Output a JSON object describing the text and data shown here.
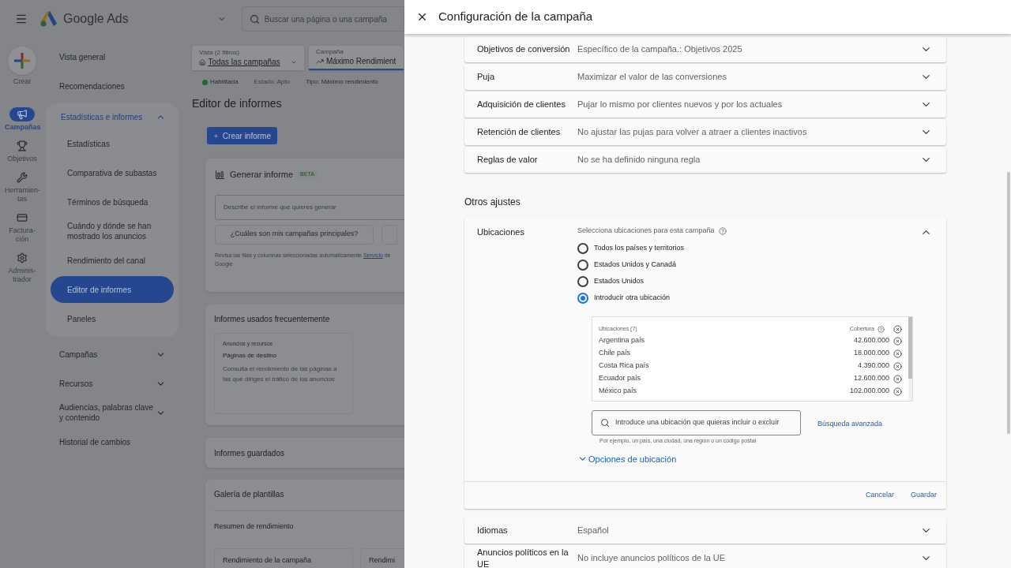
{
  "app": {
    "logo_text": "Google Ads",
    "search": {
      "placeholder": "Buscar una página o una campaña"
    }
  },
  "rail": [
    {
      "label": "Crear",
      "kind": "create",
      "selected": false
    },
    {
      "label": "Campañas",
      "kind": "campaigns",
      "selected": true
    },
    {
      "label": "Objetivos",
      "kind": "goals",
      "selected": false
    },
    {
      "label": "Herramien-tas",
      "kind": "tools",
      "selected": false
    },
    {
      "label": "Factura-ción",
      "kind": "billing",
      "selected": false
    },
    {
      "label": "Adminis-trador",
      "kind": "admin",
      "selected": false
    }
  ],
  "nav": [
    {
      "label": "Vista general",
      "selected": false
    },
    {
      "label": "Recomendaciones",
      "selected": false
    },
    {
      "label": "Estadísticas e informes",
      "selected": false,
      "expanded": true,
      "children": [
        {
          "label": "Estadísticas",
          "selected": false
        },
        {
          "label": "Comparativa de subastas",
          "selected": false
        },
        {
          "label": "Términos de búsqueda",
          "selected": false
        },
        {
          "label": "Cuándo y dónde se han mostrado los anuncios",
          "selected": false
        },
        {
          "label": "Rendimiento del canal",
          "selected": false
        },
        {
          "label": "Editor de informes",
          "selected": true
        },
        {
          "label": "Paneles",
          "selected": false
        }
      ]
    },
    {
      "label": "Campañas",
      "selected": false,
      "expanded": false
    },
    {
      "label": "Recursos",
      "selected": false,
      "expanded": false
    },
    {
      "label": "Audiencias, palabras clave y contenido",
      "selected": false,
      "expanded": false
    },
    {
      "label": "Historial de cambios",
      "selected": false
    }
  ],
  "main": {
    "filters": [
      {
        "label": "Vista (2 filtros)",
        "value": "Todas las campañas",
        "kind": "view"
      },
      {
        "label": "Campaña",
        "value": "Máximo Rendimient",
        "kind": "campaign"
      }
    ],
    "status": {
      "state": "Habilitada",
      "eligibility_label": "Estado:",
      "eligibility": "Apto",
      "type_label": "Tipo:",
      "type": "Máximo rendimiento"
    },
    "title": "Editor de informes",
    "create_button": "Crear informe",
    "generate": {
      "title": "Generar informe",
      "badge": "BETA",
      "placeholder": "Describe el informe que quieres generar",
      "suggestion": "¿Cuáles son mis campañas principales?",
      "note": "Revisa las filas y columnas seleccionadas automáticamente",
      "link": "Servicio",
      "note_end": "de Google"
    },
    "frequent": {
      "title": "Informes usados frecuentemente",
      "card": {
        "category": "Anuncios y recursos",
        "title": "Páginas de destino",
        "description": "Consulta el rendimiento de las páginas a las que diriges el tráfico de los anuncios"
      }
    },
    "saved": {
      "title": "Informes guardados"
    },
    "gallery": {
      "title": "Galería de plantillas",
      "section": "Resumen de rendimiento",
      "cards": [
        "Rendimiento de la campaña",
        "Rendimi"
      ]
    }
  },
  "panel": {
    "title": "Configuración de la campaña",
    "settings": [
      {
        "label": "Objetivos de conversión",
        "value": "Específico de la campaña.: Objetivos 2025",
        "expanded": false
      },
      {
        "label": "Puja",
        "value": "Maximizar el valor de las conversiones",
        "expanded": false
      },
      {
        "label": "Adquisición de clientes",
        "value": "Pujar lo mismo por clientes nuevos y por los actuales",
        "expanded": false
      },
      {
        "label": "Retención de clientes",
        "value": "No ajustar las pujas para volver a atraer a clientes inactivos",
        "expanded": false
      },
      {
        "label": "Reglas de valor",
        "value": "No se ha definido ninguna regla",
        "expanded": false
      }
    ],
    "section_title": "Otros ajustes",
    "locations": {
      "label": "Ubicaciones",
      "expanded": true,
      "prompt": "Selecciona ubicaciones para esta campaña",
      "options": [
        {
          "label": "Todos los países y territorios",
          "selected": false
        },
        {
          "label": "Estados Unidos y Canadá",
          "selected": false
        },
        {
          "label": "Estados Unidos",
          "selected": false
        },
        {
          "label": "Introducir otra ubicación",
          "selected": true
        }
      ],
      "table": {
        "header": "Ubicaciones (7)",
        "coverage_header": "Cobertura",
        "rows": [
          {
            "name": "Argentina país",
            "coverage": "42.600.000"
          },
          {
            "name": "Chile país",
            "coverage": "18.000.000"
          },
          {
            "name": "Costa Rica país",
            "coverage": "4.390.000"
          },
          {
            "name": "Ecuador país",
            "coverage": "12.600.000"
          },
          {
            "name": "México país",
            "coverage": "102.000.000"
          }
        ]
      },
      "search_placeholder": "Introduce una ubicación que quieras incluir o excluir",
      "advanced_link": "Búsqueda avanzada",
      "hint": "Por ejemplo, un país, una ciudad, una región o un código postal",
      "options_link": "Opciones de ubicación",
      "cancel": "Cancelar",
      "save": "Guardar"
    },
    "more_settings": [
      {
        "label": "Idiomas",
        "value": "Español",
        "expanded": false
      },
      {
        "label": "Anuncios políticos en la UE",
        "value": "No incluye anuncios políticos de la UE",
        "expanded": false
      }
    ]
  }
}
